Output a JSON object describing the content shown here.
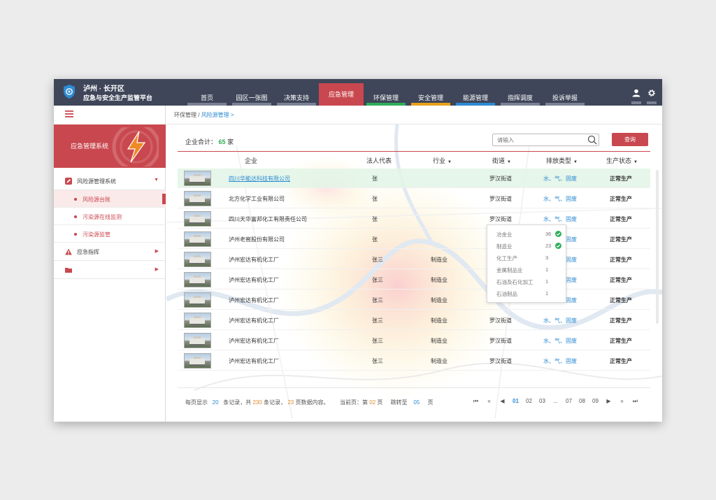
{
  "header": {
    "app_title_line1": "泸州 · 长开区",
    "app_title_line2": "应急与安全生产监管平台",
    "nav": [
      {
        "label": "首页",
        "bar": "#7b8194"
      },
      {
        "label": "园区一张图",
        "bar": "#7b8194"
      },
      {
        "label": "决策支持",
        "bar": "#7b8194"
      },
      {
        "label": "应急管理",
        "bar": "#c9484f",
        "active": true
      },
      {
        "label": "环保管理",
        "bar": "#2fae5a"
      },
      {
        "label": "安全管理",
        "bar": "#e7a21b"
      },
      {
        "label": "能源管理",
        "bar": "#2d8bd3"
      },
      {
        "label": "指挥调度",
        "bar": "#7b8194"
      },
      {
        "label": "投诉举报",
        "bar": "#7b8194"
      }
    ],
    "icons": [
      "user-icon",
      "gear-icon"
    ]
  },
  "sidebar": {
    "system_name": "应急管理系统",
    "groups": [
      {
        "label": "风险源管理系统",
        "icon": "edit-icon",
        "expanded": true
      },
      {
        "label": "应急指挥",
        "icon": "warning-icon"
      },
      {
        "label": "",
        "icon": "folder-icon"
      }
    ],
    "sub_items": [
      {
        "label": "风险源台账",
        "active": true
      },
      {
        "label": "污染源在线监测"
      },
      {
        "label": "污染源监管"
      }
    ]
  },
  "main": {
    "breadcrumb_root": "环保管理",
    "breadcrumb_current": "风险源管理 >",
    "total_label": "企业合计：",
    "total_count": "65",
    "total_unit": "家",
    "search_placeholder": "请输入",
    "query_button": "查询",
    "columns": {
      "company": "企业",
      "legal_rep": "法人代表",
      "industry": "行业",
      "street": "街道",
      "emission": "排放类型",
      "status": "生产状态"
    },
    "rows": [
      {
        "name": "四川华能达科技有限公司",
        "rep": "张",
        "industry": "",
        "street": "罗汉街道",
        "emission": "水、气、固废",
        "status": "正常生产",
        "selected": true
      },
      {
        "name": "北方化学工业有限公司",
        "rep": "张",
        "industry": "",
        "street": "罗汉街道",
        "emission": "水、气、固废",
        "status": "正常生产"
      },
      {
        "name": "四川天华富邦化工有限责任公司",
        "rep": "张",
        "industry": "",
        "street": "罗汉街道",
        "emission": "水、气、固废",
        "status": "正常生产"
      },
      {
        "name": "泸州老窖股份有限公司",
        "rep": "张",
        "industry": "",
        "street": "罗汉街道",
        "emission": "水、气、固废",
        "status": "正常生产"
      },
      {
        "name": "泸州宏达有机化工厂",
        "rep": "张三",
        "industry": "制造业",
        "street": "罗汉街道",
        "emission": "水、气、固废",
        "status": "正常生产"
      },
      {
        "name": "泸州宏达有机化工厂",
        "rep": "张三",
        "industry": "制造业",
        "street": "罗汉街道",
        "emission": "水、气、固废",
        "status": "正常生产"
      },
      {
        "name": "泸州宏达有机化工厂",
        "rep": "张三",
        "industry": "制造业",
        "street": "罗汉街道",
        "emission": "水、气、固废",
        "status": "正常生产"
      },
      {
        "name": "泸州宏达有机化工厂",
        "rep": "张三",
        "industry": "制造业",
        "street": "罗汉街道",
        "emission": "水、气、固废",
        "status": "正常生产"
      },
      {
        "name": "泸州宏达有机化工厂",
        "rep": "张三",
        "industry": "制造业",
        "street": "罗汉街道",
        "emission": "水、气、固废",
        "status": "正常生产"
      },
      {
        "name": "泸州宏达有机化工厂",
        "rep": "张三",
        "industry": "制造业",
        "street": "罗汉街道",
        "emission": "水、气、固废",
        "status": "正常生产"
      }
    ],
    "industry_filter": [
      {
        "label": "冶金业",
        "count": "36",
        "checked": true
      },
      {
        "label": "制造业",
        "count": "23",
        "checked": true
      },
      {
        "label": "化工生产",
        "count": "3",
        "checked": false
      },
      {
        "label": "金属制品业",
        "count": "1",
        "checked": false
      },
      {
        "label": "石油及石化加工",
        "count": "1",
        "checked": false
      },
      {
        "label": "石油制品",
        "count": "1",
        "checked": false
      }
    ],
    "pagination": {
      "per_page_label": "每页显示",
      "per_page": "20",
      "records_label": "条记录，共",
      "total_records": "230",
      "records_unit": "条记录，",
      "total_pages": "23",
      "pages_unit": "页数据内容。",
      "current_label": "当前页：第",
      "current_page": "02",
      "current_unit": "页",
      "jump_label": "跳转至",
      "jump_value": "05",
      "jump_unit": "页",
      "pages": [
        "01",
        "02",
        "03",
        "...",
        "07",
        "08",
        "09"
      ],
      "active_page": "01"
    }
  }
}
